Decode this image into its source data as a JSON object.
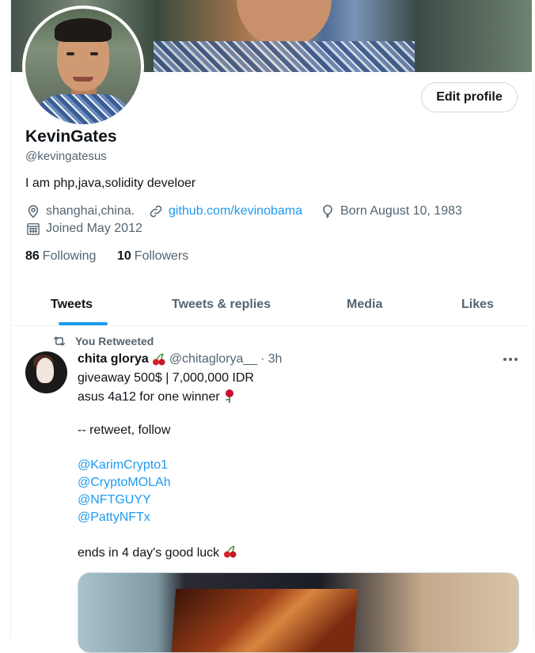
{
  "profile": {
    "name": "KevinGates",
    "handle": "@kevingatesus",
    "bio": "I am php,java,solidity develoer",
    "location": "shanghai,china.",
    "website": "github.com/kevinobama",
    "birthday": "Born August 10, 1983",
    "joined": "Joined May 2012",
    "following_count": "86",
    "following_label": "Following",
    "followers_count": "10",
    "followers_label": "Followers",
    "edit_button": "Edit profile"
  },
  "tabs": [
    {
      "label": "Tweets",
      "active": true
    },
    {
      "label": "Tweets & replies",
      "active": false
    },
    {
      "label": "Media",
      "active": false
    },
    {
      "label": "Likes",
      "active": false
    }
  ],
  "tweet": {
    "retweet_label": "You Retweeted",
    "author": "chita glorya",
    "author_emoji": "cherry",
    "handle": "@chitaglorya__",
    "separator": "·",
    "time": "3h",
    "line1": "giveaway 500$ | 7,000,000 IDR",
    "line2": "asus 4a12 for one winner",
    "line2_emoji": "rose",
    "line3": "-- retweet, follow",
    "mentions": [
      "@KarimCrypto1",
      "@CryptoMOLAh",
      "@NFTGUYY",
      "@PattyNFTx"
    ],
    "line4": "ends in 4 day's good luck",
    "line4_emoji": "cherry"
  },
  "icons": [
    "location-icon",
    "link-icon",
    "balloon-icon",
    "calendar-icon",
    "retweet-icon",
    "more-icon"
  ],
  "colors": {
    "accent": "#1d9bf0",
    "secondary_text": "#536471",
    "text": "#0f1419",
    "border": "#cfd9de"
  }
}
